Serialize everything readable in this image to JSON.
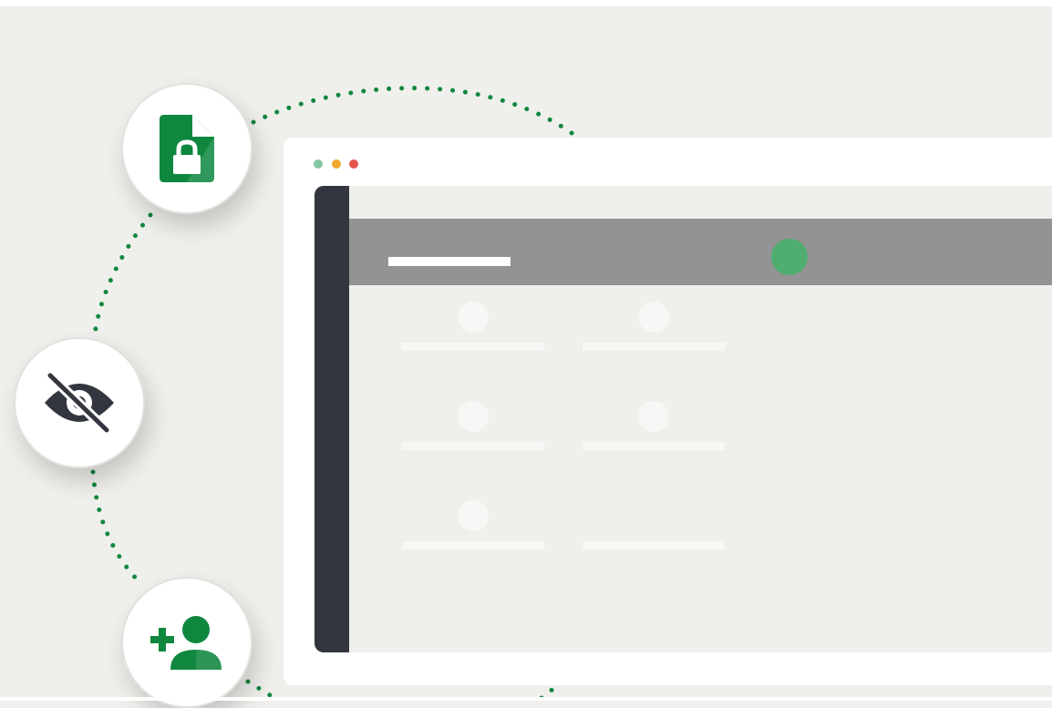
{
  "colors": {
    "background": "#efefeb",
    "brand_green": "#0f873f",
    "window_bg": "#ffffff",
    "sidebar": "#33363e",
    "header_bar": "#939393",
    "header_avatar": "#4fad6f",
    "placeholder": "#f7f7f6",
    "icon_dark": "#33363e"
  },
  "window_controls": [
    {
      "name": "green-dot",
      "color": "#87c6a2"
    },
    {
      "name": "yellow-dot",
      "color": "#f0a92c"
    },
    {
      "name": "red-dot",
      "color": "#e5554b"
    }
  ],
  "features": [
    {
      "icon": "locked-file-icon"
    },
    {
      "icon": "eye-slash-icon"
    },
    {
      "icon": "add-user-icon"
    }
  ]
}
